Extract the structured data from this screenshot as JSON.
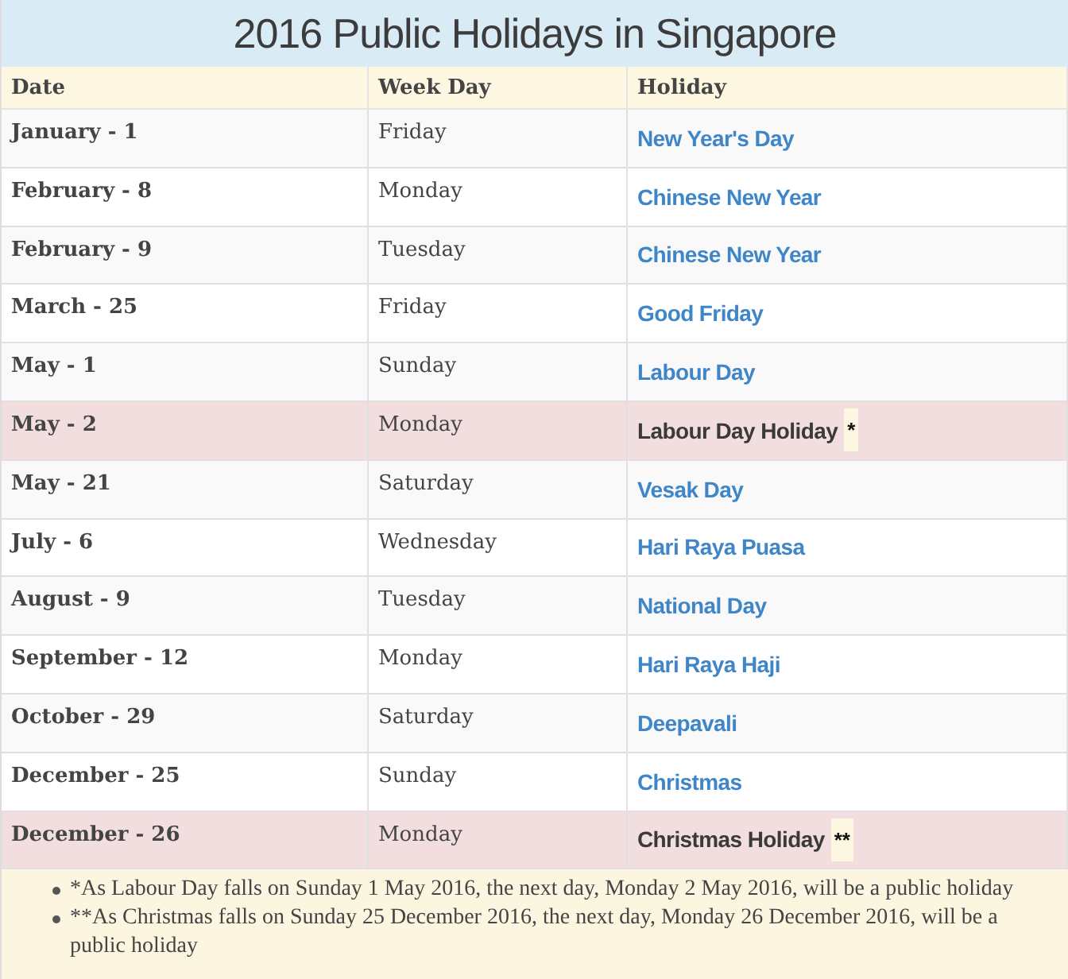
{
  "title": "2016 Public Holidays in Singapore",
  "columns": [
    "Date",
    "Week Day",
    "Holiday"
  ],
  "rows": [
    {
      "date": "January - 1",
      "weekday": "Friday",
      "holiday": "New Year's Day",
      "observed": false
    },
    {
      "date": "February - 8",
      "weekday": "Monday",
      "holiday": "Chinese New Year",
      "observed": false
    },
    {
      "date": "February - 9",
      "weekday": "Tuesday",
      "holiday": "Chinese New Year",
      "observed": false
    },
    {
      "date": "March - 25",
      "weekday": "Friday",
      "holiday": "Good Friday",
      "observed": false
    },
    {
      "date": "May - 1",
      "weekday": "Sunday",
      "holiday": "Labour Day",
      "observed": false
    },
    {
      "date": "May - 2",
      "weekday": "Monday",
      "holiday": "Labour Day Holiday",
      "mark": "*",
      "observed": true
    },
    {
      "date": "May - 21",
      "weekday": "Saturday",
      "holiday": "Vesak Day",
      "observed": false
    },
    {
      "date": "July - 6",
      "weekday": "Wednesday",
      "holiday": "Hari Raya Puasa",
      "observed": false
    },
    {
      "date": "August - 9",
      "weekday": "Tuesday",
      "holiday": "National Day",
      "observed": false
    },
    {
      "date": "September - 12",
      "weekday": "Monday",
      "holiday": "Hari Raya Haji",
      "observed": false
    },
    {
      "date": "October - 29",
      "weekday": "Saturday",
      "holiday": "Deepavali",
      "observed": false
    },
    {
      "date": "December - 25",
      "weekday": "Sunday",
      "holiday": "Christmas",
      "observed": false
    },
    {
      "date": "December - 26",
      "weekday": "Monday",
      "holiday": "Christmas Holiday",
      "mark": "**",
      "observed": true
    }
  ],
  "notes": [
    "*As Labour Day falls on Sunday 1 May 2016, the next day, Monday 2 May 2016, will be a public holiday",
    "**As Christmas falls on Sunday 25 December 2016, the next day, Monday 26 December 2016, will be a public holiday"
  ]
}
